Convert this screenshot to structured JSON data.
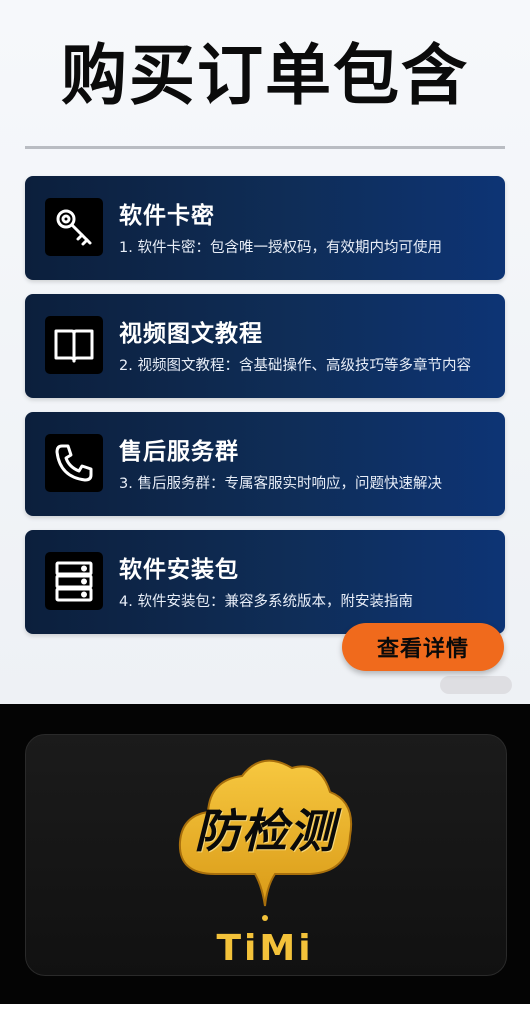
{
  "header": {
    "title": "购买订单包含"
  },
  "items": [
    {
      "title": "软件卡密",
      "desc": "1. 软件卡密：包含唯一授权码，有效期内均可使用",
      "icon": "key-icon"
    },
    {
      "title": "视频图文教程",
      "desc": "2. 视频图文教程：含基础操作、高级技巧等多章节内容",
      "icon": "book-icon"
    },
    {
      "title": "售后服务群",
      "desc": "3. 售后服务群：专属客服实时响应，问题快速解决",
      "icon": "phone-icon"
    },
    {
      "title": "软件安装包",
      "desc": "4. 软件安装包：兼容多系统版本，附安装指南",
      "icon": "server-icon"
    }
  ],
  "cta": {
    "label": "查看详情"
  },
  "banner": {
    "badge": "防检测",
    "brand": "TiMi"
  },
  "colors": {
    "card": "#0f2d57",
    "cta": "#f06a1c",
    "gold": "#f3c23a"
  }
}
